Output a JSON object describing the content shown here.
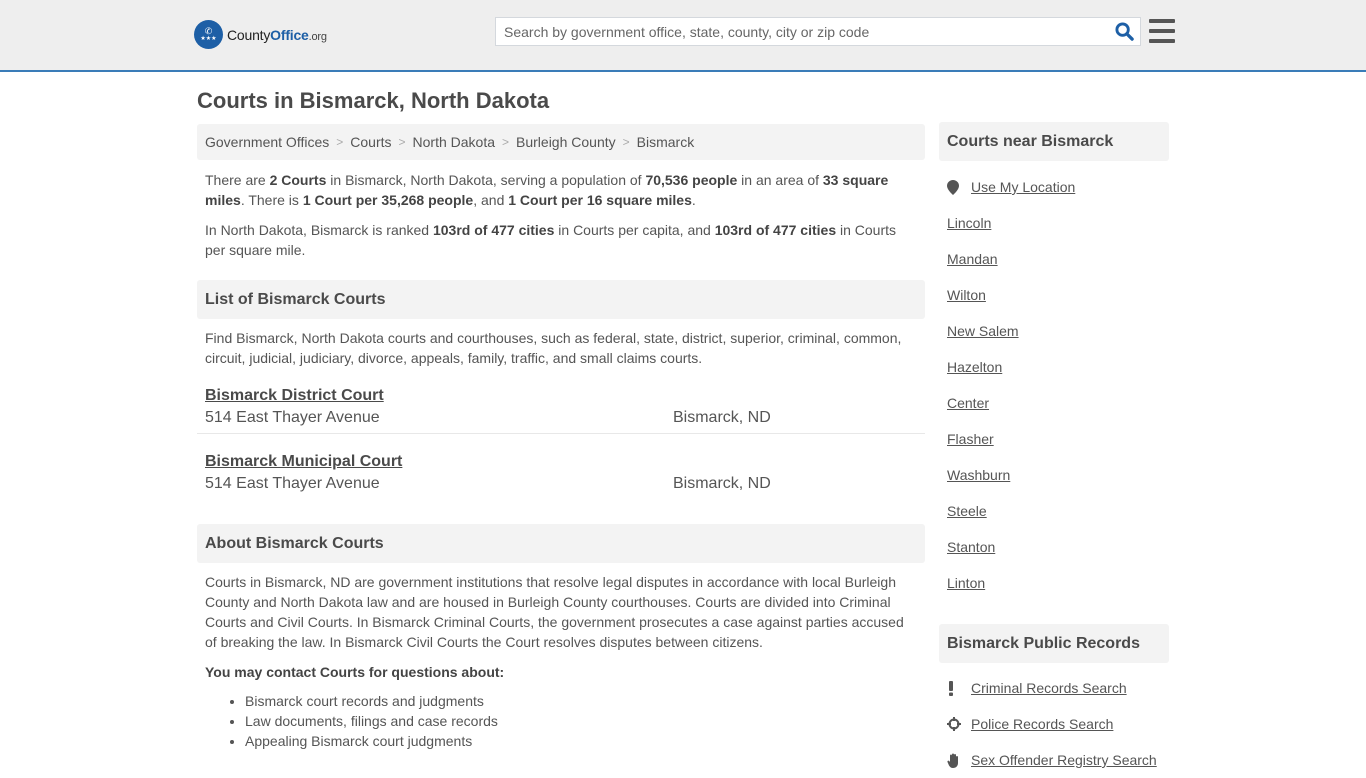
{
  "header": {
    "logo": {
      "name": "County",
      "office": "Office",
      "tld": ".org"
    },
    "search": {
      "placeholder": "Search by government office, state, county, city or zip code",
      "value": ""
    }
  },
  "page_title": "Courts in Bismarck, North Dakota",
  "breadcrumb": [
    "Government Offices",
    "Courts",
    "North Dakota",
    "Burleigh County",
    "Bismarck"
  ],
  "intro": {
    "p1": {
      "t1": "There are ",
      "b1": "2 Courts",
      "t2": " in Bismarck, North Dakota, serving a population of ",
      "b2": "70,536 people",
      "t3": " in an area of ",
      "b3": "33 square miles",
      "t4": ". There is ",
      "b4": "1 Court per 35,268 people",
      "t5": ", and ",
      "b5": "1 Court per 16 square miles",
      "t6": "."
    },
    "p2": {
      "t1": "In North Dakota, Bismarck is ranked ",
      "b1": "103rd of 477 cities",
      "t2": " in Courts per capita, and ",
      "b2": "103rd of 477 cities",
      "t3": " in Courts per square mile."
    }
  },
  "list_section": {
    "title": "List of Bismarck Courts",
    "description": "Find Bismarck, North Dakota courts and courthouses, such as federal, state, district, superior, criminal, common, circuit, judicial, judiciary, divorce, appeals, family, traffic, and small claims courts.",
    "courts": [
      {
        "name": "Bismarck District Court",
        "address": "514 East Thayer Avenue",
        "city": "Bismarck, ND"
      },
      {
        "name": "Bismarck Municipal Court",
        "address": "514 East Thayer Avenue",
        "city": "Bismarck, ND"
      }
    ]
  },
  "about_section": {
    "title": "About Bismarck Courts",
    "text": "Courts in Bismarck, ND are government institutions that resolve legal disputes in accordance with local Burleigh County and North Dakota law and are housed in Burleigh County courthouses. Courts are divided into Criminal Courts and Civil Courts. In Bismarck Criminal Courts, the government prosecutes a case against parties accused of breaking the law. In Bismarck Civil Courts the Court resolves disputes between citizens.",
    "contact_heading": "You may contact Courts for questions about:",
    "contact_items": [
      "Bismarck court records and judgments",
      "Law documents, filings and case records",
      "Appealing Bismarck court judgments"
    ]
  },
  "sidebar": {
    "near": {
      "title": "Courts near Bismarck",
      "use_location": "Use My Location",
      "cities": [
        "Lincoln",
        "Mandan",
        "Wilton",
        "New Salem",
        "Hazelton",
        "Center",
        "Flasher",
        "Washburn",
        "Steele",
        "Stanton",
        "Linton"
      ]
    },
    "records": {
      "title": "Bismarck Public Records",
      "links": [
        {
          "label": "Criminal Records Search",
          "icon": "exclamation-icon"
        },
        {
          "label": "Police Records Search",
          "icon": "crosshair-icon"
        },
        {
          "label": "Sex Offender Registry Search",
          "icon": "hand-icon"
        }
      ]
    }
  },
  "colors": {
    "brand_blue": "#1d5fa6",
    "header_border": "#3a7cb8",
    "header_bg": "#eeeeee",
    "panel_bg": "#f3f3f3"
  }
}
